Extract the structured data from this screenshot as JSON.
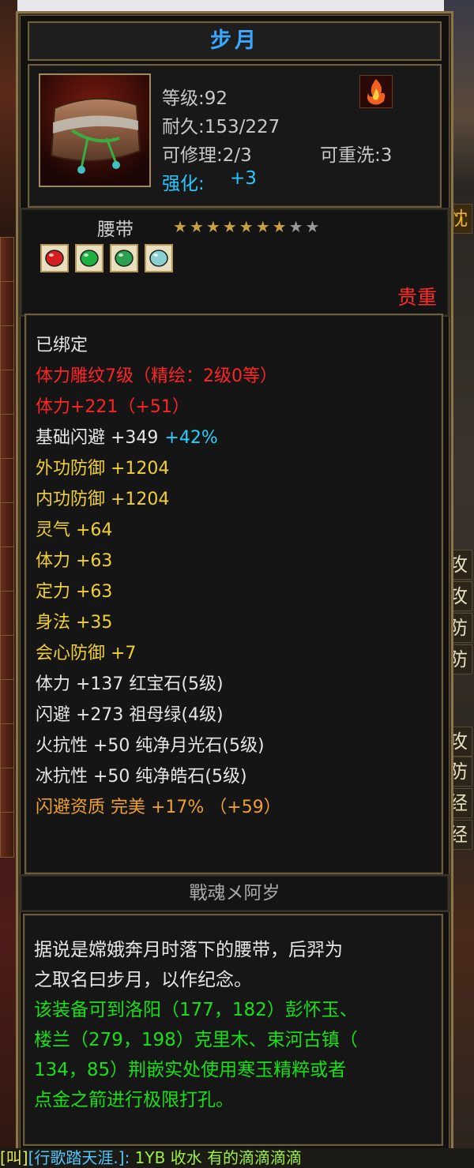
{
  "item": {
    "name": "步月",
    "level": "等级:92",
    "durability": "耐久:153/227",
    "repair": "可修理:2/3",
    "rewash": "可重洗:3",
    "enhance_label": "强化:",
    "enhance_value": "+3",
    "type": "腰带",
    "stars_filled": 7,
    "stars_total": 9,
    "quality": "贵重",
    "maker": "戰魂メ阿岁"
  },
  "gems": [
    {
      "icon": "ruby-gem-icon",
      "color": "#d42020"
    },
    {
      "icon": "emerald-gem-icon",
      "color": "#20b040"
    },
    {
      "icon": "jade-gem-icon",
      "color": "#2aa050"
    },
    {
      "icon": "moonstone-gem-icon",
      "color": "#8ad0d0"
    }
  ],
  "attributes": [
    {
      "text": "已绑定",
      "color": "white"
    },
    {
      "text": "体力雕纹7级（精绘：2级0等）",
      "color": "red"
    },
    {
      "text": "体力+221（+51）",
      "color": "red"
    },
    {
      "text": "基础闪避 +349",
      "extra": "+42%",
      "color": "white"
    },
    {
      "text": "外功防御 +1204",
      "color": "yellow"
    },
    {
      "text": "内功防御 +1204",
      "color": "yellow"
    },
    {
      "text": "灵气 +64",
      "color": "yellow"
    },
    {
      "text": "体力 +63",
      "color": "yellow"
    },
    {
      "text": "定力 +63",
      "color": "yellow"
    },
    {
      "text": "身法 +35",
      "color": "yellow"
    },
    {
      "text": "会心防御 +7",
      "color": "yellow"
    },
    {
      "text": "体力 +137 红宝石(5级)",
      "color": "white"
    },
    {
      "text": "闪避 +273 祖母绿(4级)",
      "color": "white"
    },
    {
      "text": "火抗性 +50 纯净月光石(5级)",
      "color": "white"
    },
    {
      "text": "冰抗性 +50 纯净皓石(5级)",
      "color": "white"
    },
    {
      "text": "闪避资质  完美 +17% （+59）",
      "color": "orange"
    }
  ],
  "description": {
    "lines_white": [
      "据说是嫦娥奔月时落下的腰带，后羿为",
      "之取名曰步月，以作纪念。"
    ],
    "lines_green": [
      "该装备可到洛阳（177，182）彭怀玉、",
      "楼兰（279，198）克里木、束河古镇（",
      "134，85）荆嵌实处使用寒玉精粹或者",
      "点金之箭进行极限打孔。"
    ]
  },
  "chat": {
    "prefix": "[叫]",
    "channel": "[行歌踏天涯.]:",
    "speaker": "1YB 收水",
    "message": "有的滴滴滴滴"
  },
  "right_edge": [
    "攻",
    "攻",
    "防",
    "防",
    "攻",
    "防",
    "经",
    "经"
  ],
  "right_edge_top": "忱",
  "colors": {
    "title": "#3aa8ff",
    "red": "#ff2424",
    "yellow": "#f0d034",
    "green": "#18e018",
    "frame": "#8a7448"
  }
}
